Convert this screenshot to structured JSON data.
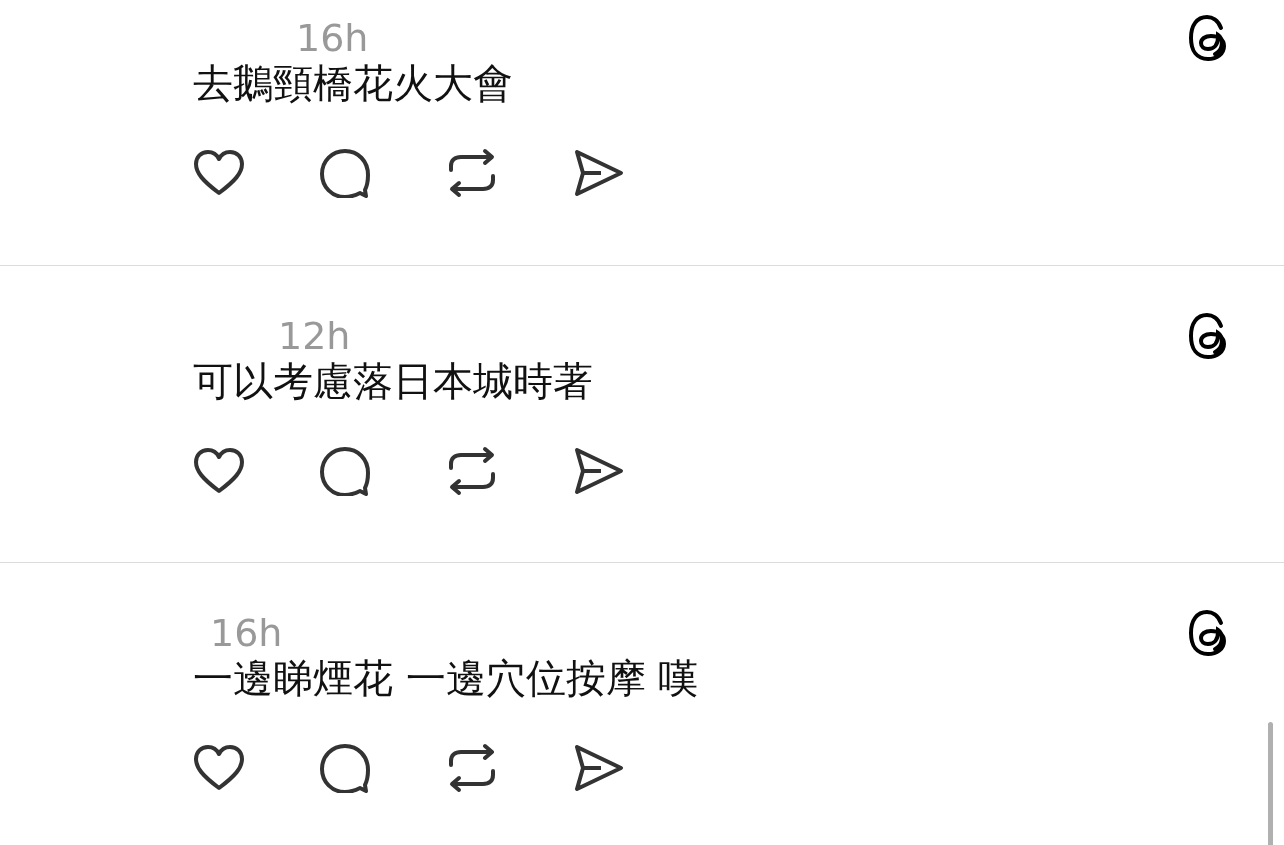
{
  "posts": [
    {
      "time": "16h",
      "text": "去鵝頸橋花火大會"
    },
    {
      "time": "12h",
      "text": "可以考慮落日本城時著"
    },
    {
      "time": "16h",
      "text": "一邊睇煙花 一邊穴位按摩 嘆"
    }
  ]
}
